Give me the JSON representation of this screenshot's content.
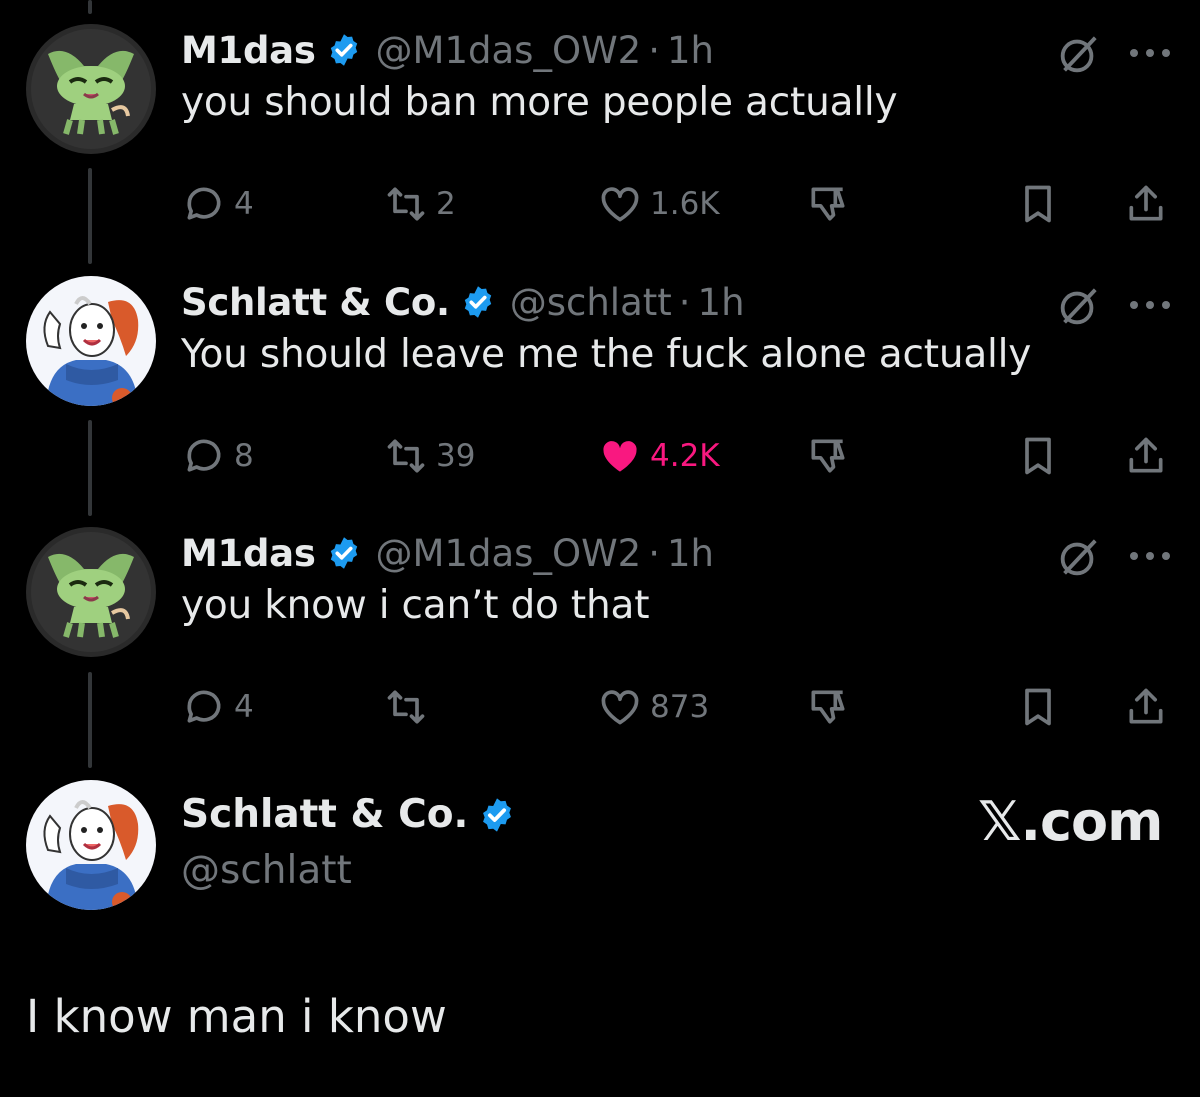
{
  "colors": {
    "background": "#000000",
    "primary_text": "#e7e9ea",
    "secondary_text": "#71767b",
    "verified_blue": "#1d9bf0",
    "like_pink": "#f91880",
    "thread_line": "#333639"
  },
  "tweets": [
    {
      "display_name": "M1das",
      "handle": "@M1das_OW2",
      "separator": "·",
      "time": "1h",
      "text": "you should ban more people actually",
      "avatar": "green-cat-avatar",
      "replies": "4",
      "reposts": "2",
      "likes": "1.6K",
      "liked": false
    },
    {
      "display_name": "Schlatt & Co.",
      "handle": "@schlatt",
      "separator": "·",
      "time": "1h",
      "text": "You should leave me the fuck alone actually",
      "avatar": "goat-cartoon-avatar",
      "replies": "8",
      "reposts": "39",
      "likes": "4.2K",
      "liked": true
    },
    {
      "display_name": "M1das",
      "handle": "@M1das_OW2",
      "separator": "·",
      "time": "1h",
      "text": "you know i can’t do that",
      "avatar": "green-cat-avatar",
      "replies": "4",
      "reposts": "",
      "likes": "873",
      "liked": false
    }
  ],
  "focused_tweet": {
    "display_name": "Schlatt & Co.",
    "handle": "@schlatt",
    "text": "I know man i know",
    "avatar": "goat-cartoon-avatar"
  },
  "watermark": "𝕏.com"
}
